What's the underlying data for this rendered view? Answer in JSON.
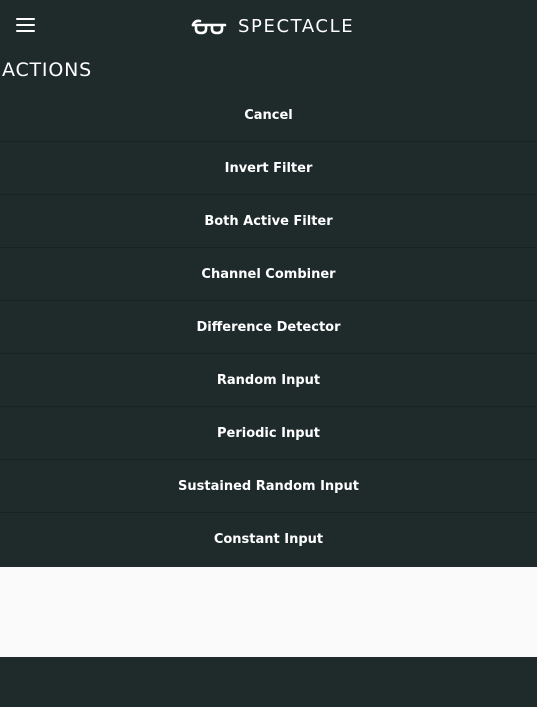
{
  "header": {
    "menu_icon": "hamburger-menu-icon",
    "brand_logo_icon": "glasses-logo-icon",
    "brand_name": "SPECTACLE"
  },
  "section": {
    "title": "ACTIONS"
  },
  "actions": [
    {
      "label": "Cancel"
    },
    {
      "label": "Invert Filter"
    },
    {
      "label": "Both Active Filter"
    },
    {
      "label": "Channel Combiner"
    },
    {
      "label": "Difference Detector"
    },
    {
      "label": "Random Input"
    },
    {
      "label": "Periodic Input"
    },
    {
      "label": "Sustained Random Input"
    },
    {
      "label": "Constant Input"
    }
  ],
  "colors": {
    "background": "#1f2a2b",
    "divider": "#192324",
    "text": "#ffffff",
    "panel": "#fafafa"
  }
}
